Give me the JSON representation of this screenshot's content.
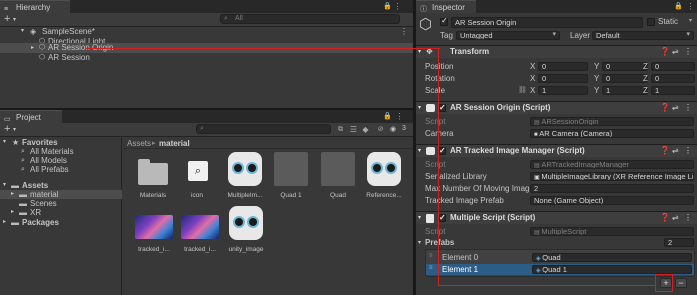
{
  "hierarchy": {
    "tab": "Hierarchy",
    "search_placeholder": "All",
    "scene": "SampleScene*",
    "items": [
      "Directional Light",
      "AR Session Origin",
      "AR Session"
    ]
  },
  "project": {
    "tab": "Project",
    "count_badge": "3",
    "favorites": {
      "label": "Favorites",
      "items": [
        "All Materials",
        "All Models",
        "All Prefabs"
      ]
    },
    "assets": {
      "label": "Assets",
      "items": [
        "material",
        "Scenes",
        "XR"
      ]
    },
    "packages": "Packages",
    "breadcrumb": [
      "Assets",
      "material"
    ],
    "grid": [
      {
        "label": "Materials",
        "kind": "folder"
      },
      {
        "label": "icon",
        "kind": "icon"
      },
      {
        "label": "MultipleIm...",
        "kind": "robot"
      },
      {
        "label": "Quad 1",
        "kind": "gray"
      },
      {
        "label": "Quad",
        "kind": "gray"
      },
      {
        "label": "Reference...",
        "kind": "robot"
      },
      {
        "label": "tracked_i...",
        "kind": "thumb"
      },
      {
        "label": "tracked_i...",
        "kind": "thumb"
      },
      {
        "label": "unity_image",
        "kind": "robot"
      }
    ]
  },
  "inspector": {
    "tab": "Inspector",
    "object_name": "AR Session Origin",
    "static_label": "Static",
    "tag_label": "Tag",
    "tag_value": "Untagged",
    "layer_label": "Layer",
    "layer_value": "Default",
    "transform": {
      "title": "Transform",
      "rows": [
        {
          "label": "Position",
          "x": "0",
          "y": "0",
          "z": "0"
        },
        {
          "label": "Rotation",
          "x": "0",
          "y": "0",
          "z": "0"
        },
        {
          "label": "Scale",
          "x": "1",
          "y": "1",
          "z": "1"
        }
      ]
    },
    "session_origin": {
      "title": "AR Session Origin (Script)",
      "script_label": "Script",
      "script_value": "ARSessionOrigin",
      "camera_label": "Camera",
      "camera_value": "AR Camera (Camera)"
    },
    "tracked_image": {
      "title": "AR Tracked Image Manager (Script)",
      "script_label": "Script",
      "script_value": "ARTrackedImageManager",
      "lib_label": "Serialized Library",
      "lib_value": "MultipleImageLibrary (XR Reference Image Li",
      "max_label": "Max Number Of Moving Images",
      "max_value": "2",
      "prefab_label": "Tracked Image Prefab",
      "prefab_value": "None (Game Object)"
    },
    "multiple": {
      "title": "Multiple Script (Script)",
      "script_label": "Script",
      "script_value": "MultipleScript",
      "prefabs_label": "Prefabs",
      "prefabs_count": "2",
      "elements": [
        {
          "label": "Element 0",
          "value": "Quad"
        },
        {
          "label": "Element 1",
          "value": "Quad 1"
        }
      ],
      "add_label": "+",
      "remove_label": "−"
    }
  },
  "colors": {
    "annotation": "#d41f1f",
    "selection": "#2c5d87"
  }
}
